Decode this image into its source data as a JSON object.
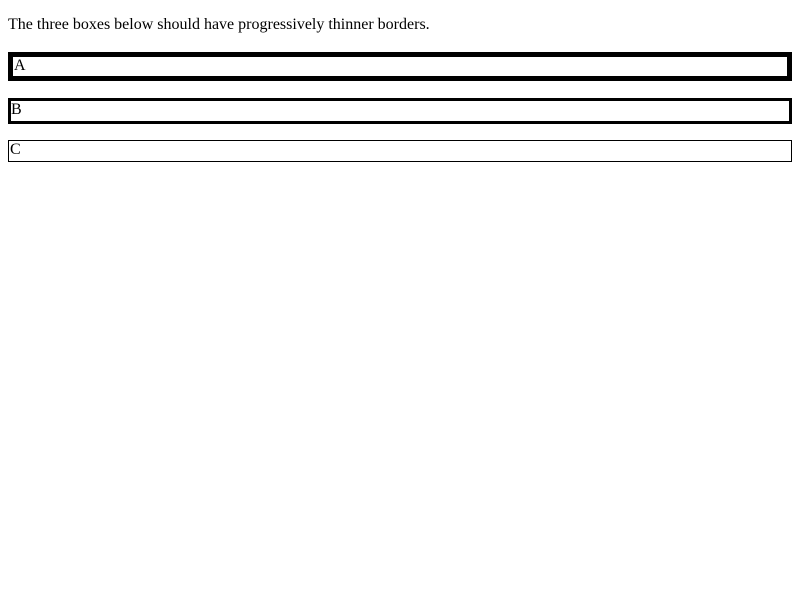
{
  "intro": {
    "text": "The three boxes below should have progressively thinner borders."
  },
  "boxes": [
    {
      "label": "A",
      "border_style": "thick"
    },
    {
      "label": "B",
      "border_style": "medium"
    },
    {
      "label": "C",
      "border_style": "thin"
    }
  ],
  "colors": {
    "border": "#000000",
    "background": "#ffffff",
    "text": "#000000"
  }
}
